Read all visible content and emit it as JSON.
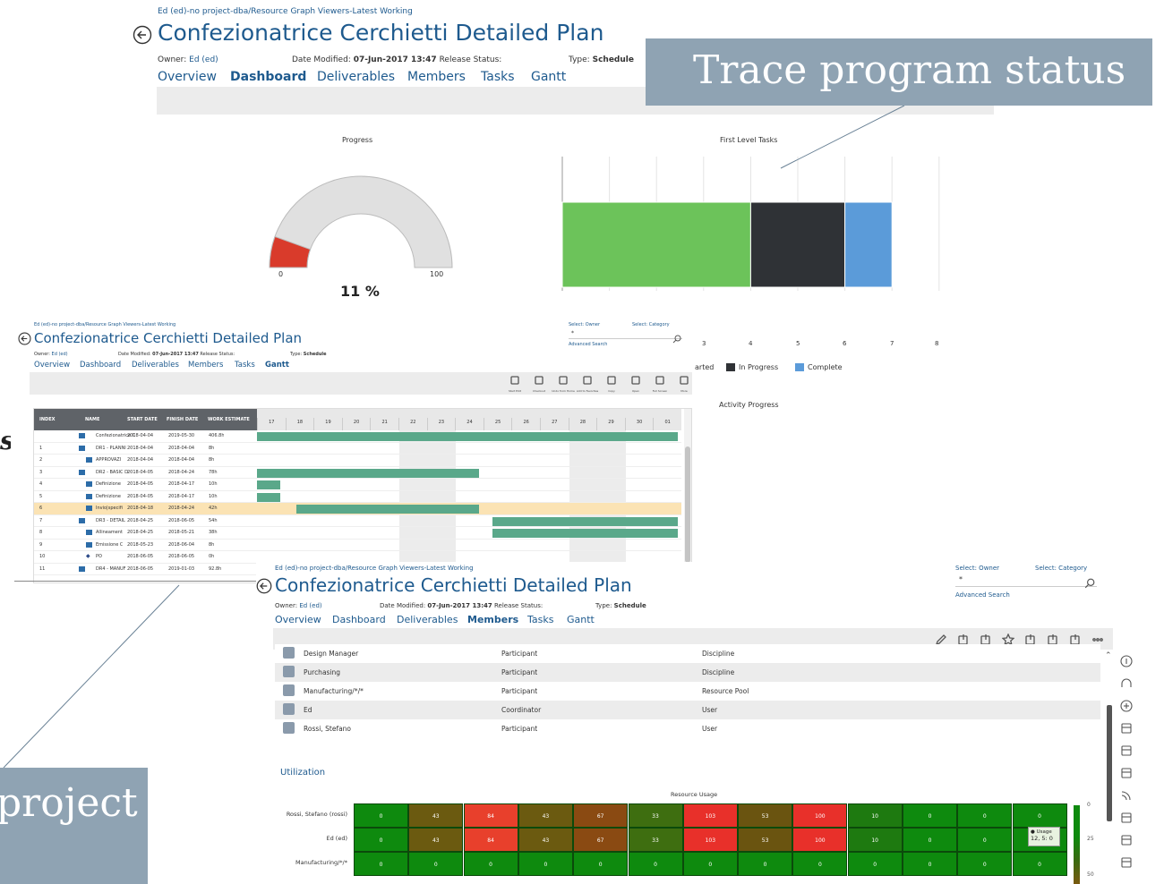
{
  "top": {
    "breadcrumb": "Ed (ed)-no project-dba/Resource Graph Viewers-Latest Working",
    "title": "Confezionatrice Cerchietti Detailed Plan",
    "owner_label": "Owner:",
    "owner_value": "Ed (ed)",
    "date_label": "Date Modified:",
    "date_value": "07-Jun-2017 13:47",
    "release_label": "Release Status:",
    "type_label": "Type:",
    "type_value": "Schedule",
    "tabs": [
      "Overview",
      "Dashboard",
      "Deliverables",
      "Members",
      "Tasks",
      "Gantt"
    ],
    "active_tab": "Dashboard",
    "progress_title": "Progress",
    "gauge_min": "0",
    "gauge_max": "100",
    "gauge_value_text": "11 %",
    "gauge_fraction": 0.11,
    "first_level_title": "First Level Tasks",
    "axis_ticks": [
      "3",
      "4",
      "5",
      "6",
      "7",
      "8"
    ],
    "legend": {
      "started": "arted",
      "in_progress": "In Progress",
      "complete": "Complete"
    },
    "activity_title": "Activity Progress",
    "bar_segments": [
      {
        "name": "Not Started",
        "value": 4,
        "color": "#6cc35a"
      },
      {
        "name": "In Progress",
        "value": 2,
        "color": "#2f3236"
      },
      {
        "name": "Complete",
        "value": 1,
        "color": "#5b9bd9"
      }
    ]
  },
  "callouts": {
    "trace": "Trace program status",
    "project": "project"
  },
  "gantt_panel": {
    "breadcrumb": "Ed (ed)-no project-dba/Resource Graph Viewers-Latest Working",
    "title": "Confezionatrice Cerchietti Detailed Plan",
    "owner_label": "Owner:",
    "owner_value": "Ed (ed)",
    "date_label": "Date Modified:",
    "date_value": "07-Jun-2017 13:47",
    "release_label": "Release Status:",
    "type_label": "Type:",
    "type_value": "Schedule",
    "tabs": [
      "Overview",
      "Dashboard",
      "Deliverables",
      "Members",
      "Tasks",
      "Gantt"
    ],
    "active_tab": "Gantt",
    "select_owner": "Select: Owner",
    "select_category": "Select: Category",
    "search_value": "*",
    "advanced_search": "Advanced Search",
    "toolbar": [
      "Start Edit",
      "Checkout",
      "Undo from Home",
      "Add to Favorites",
      "Copy",
      "Open",
      "Full Screen",
      "More"
    ],
    "headers": [
      "INDEX",
      "NAME",
      "START DATE",
      "FINISH DATE",
      "WORK ESTIMATE"
    ],
    "days": [
      "17",
      "18",
      "19",
      "20",
      "21",
      "22",
      "23",
      "24",
      "25",
      "26",
      "27",
      "28",
      "29",
      "30",
      "01"
    ],
    "rows": [
      {
        "index": "",
        "name": "Confezionatrice C",
        "start": "2018-04-04",
        "finish": "2019-05-30",
        "work": "406.8h"
      },
      {
        "index": "1",
        "name": "DR1 - PLANNI",
        "start": "2018-04-04",
        "finish": "2018-04-04",
        "work": "8h"
      },
      {
        "index": "2",
        "name": "APPROVAZI",
        "start": "2018-04-04",
        "finish": "2018-04-04",
        "work": "8h"
      },
      {
        "index": "3",
        "name": "DR2 - BASIC D",
        "start": "2018-04-05",
        "finish": "2018-04-24",
        "work": "78h"
      },
      {
        "index": "4",
        "name": "Definizione",
        "start": "2018-04-05",
        "finish": "2018-04-17",
        "work": "10h"
      },
      {
        "index": "5",
        "name": "Definizione",
        "start": "2018-04-05",
        "finish": "2018-04-17",
        "work": "10h"
      },
      {
        "index": "6",
        "name": "Invio|specifi",
        "start": "2018-04-18",
        "finish": "2018-04-24",
        "work": "42h"
      },
      {
        "index": "7",
        "name": "DR3 - DETAIL",
        "start": "2018-04-25",
        "finish": "2018-06-05",
        "work": "54h"
      },
      {
        "index": "8",
        "name": "Allineament",
        "start": "2018-04-25",
        "finish": "2018-05-21",
        "work": "38h"
      },
      {
        "index": "9",
        "name": "Emissione C",
        "start": "2018-05-23",
        "finish": "2018-06-04",
        "work": "8h"
      },
      {
        "index": "10",
        "name": "PO",
        "start": "2018-06-05",
        "finish": "2018-06-05",
        "work": "0h"
      },
      {
        "index": "11",
        "name": "DR4 - MANUF",
        "start": "2018-06-05",
        "finish": "2019-01-03",
        "work": "92.8h"
      }
    ]
  },
  "members_panel": {
    "breadcrumb": "Ed (ed)-no project-dba/Resource Graph Viewers-Latest Working",
    "title": "Confezionatrice Cerchietti Detailed Plan",
    "owner_label": "Owner:",
    "owner_value": "Ed (ed)",
    "date_label": "Date Modified:",
    "date_value": "07-Jun-2017 13:47",
    "release_label": "Release Status:",
    "type_label": "Type:",
    "type_value": "Schedule",
    "tabs": [
      "Overview",
      "Dashboard",
      "Deliverables",
      "Members",
      "Tasks",
      "Gantt"
    ],
    "active_tab": "Members",
    "select_owner": "Select: Owner",
    "select_category": "Select: Category",
    "search_value": "*",
    "advanced_search": "Advanced Search",
    "members": [
      {
        "name": "Design Manager",
        "role": "Participant",
        "type": "Discipline"
      },
      {
        "name": "Purchasing",
        "role": "Participant",
        "type": "Discipline"
      },
      {
        "name": "Manufacturing/*/*",
        "role": "Participant",
        "type": "Resource Pool"
      },
      {
        "name": "Ed",
        "role": "Coordinator",
        "type": "User"
      },
      {
        "name": "Rossi, Stefano",
        "role": "Participant",
        "type": "User"
      }
    ],
    "utilization_label": "Utilization",
    "resource_usage_title": "Resource Usage",
    "heatmap_rows": [
      {
        "label": "Rossi, Stefano (rossi)",
        "values": [
          "0",
          "43",
          "84",
          "43",
          "67",
          "33",
          "103",
          "53",
          "100",
          "10",
          "0",
          "0",
          "0"
        ]
      },
      {
        "label": "Ed (ed)",
        "values": [
          "0",
          "43",
          "84",
          "43",
          "67",
          "33",
          "103",
          "53",
          "100",
          "10",
          "0",
          "0",
          "0"
        ]
      },
      {
        "label": "Manufacturing/*/*",
        "values": [
          "0",
          "0",
          "0",
          "0",
          "0",
          "0",
          "0",
          "0",
          "0",
          "0",
          "0",
          "0",
          "0"
        ]
      }
    ],
    "heat_colors": [
      "#0e8a0e",
      "#6b5a10",
      "#e8402c",
      "#6b5a10",
      "#8a4a12",
      "#3e6e10",
      "#e8302a",
      "#6a5410",
      "#e8302a",
      "#1e7a10",
      "#0e8a0e",
      "#0e8a0e",
      "#0e8a0e"
    ],
    "tooltip_title": "Usage",
    "tooltip_value": "12, 5: 0",
    "scale": [
      "0",
      "25",
      "50"
    ]
  }
}
